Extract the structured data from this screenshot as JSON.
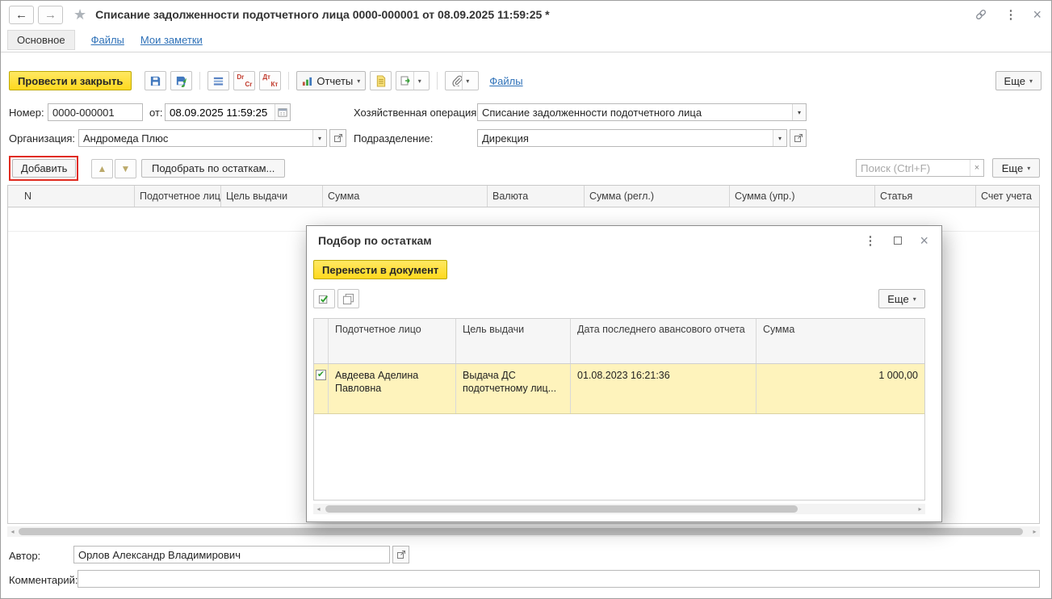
{
  "titlebar": {
    "title": "Списание задолженности подотчетного лица 0000-000001 от 08.09.2025 11:59:25 *"
  },
  "tabs": {
    "main": "Основное",
    "files": "Файлы",
    "notes": "Мои заметки"
  },
  "toolbar": {
    "post_and_close": "Провести и закрыть",
    "reports": "Отчеты",
    "files_link": "Файлы",
    "more": "Еще",
    "drcr_top": "Dr",
    "drcr_bottom": "Cr",
    "dtkt_top": "Дт",
    "dtkt_bottom": "Кт"
  },
  "fields": {
    "number_label": "Номер:",
    "number_value": "0000-000001",
    "date_label": "от:",
    "date_value": "08.09.2025 11:59:25",
    "operation_label": "Хозяйственная операция:",
    "operation_value": "Списание задолженности подотчетного лица",
    "organization_label": "Организация:",
    "organization_value": "Андромеда Плюс",
    "department_label": "Подразделение:",
    "department_value": "Дирекция"
  },
  "grid_toolbar": {
    "add": "Добавить",
    "pick_by_balances": "Подобрать по остаткам...",
    "search_placeholder": "Поиск (Ctrl+F)",
    "more": "Еще"
  },
  "grid": {
    "columns": [
      "N",
      "Подотчетное лицо",
      "Цель выдачи",
      "Сумма",
      "Валюта",
      "Сумма (регл.)",
      "Сумма (упр.)",
      "Статья",
      "Счет учета"
    ]
  },
  "dialog": {
    "title": "Подбор по остаткам",
    "transfer": "Перенести в документ",
    "more": "Еще",
    "columns": [
      "Подотчетное лицо",
      "Цель выдачи",
      "Дата последнего авансового отчета",
      "Сумма"
    ],
    "row": {
      "person": "Авдеева Аделина Павловна",
      "purpose": "Выдача ДС подотчетному лиц...",
      "date": "01.08.2023 16:21:36",
      "amount": "1 000,00"
    }
  },
  "footer": {
    "author_label": "Автор:",
    "author_value": "Орлов Александр Владимирович",
    "comment_label": "Комментарий:",
    "comment_value": ""
  },
  "colors": {
    "accent_yellow": "#FFD91E",
    "link_blue": "#2E71B8",
    "selected_row": "#FEF3BC",
    "annotation_red": "#E02B20"
  }
}
